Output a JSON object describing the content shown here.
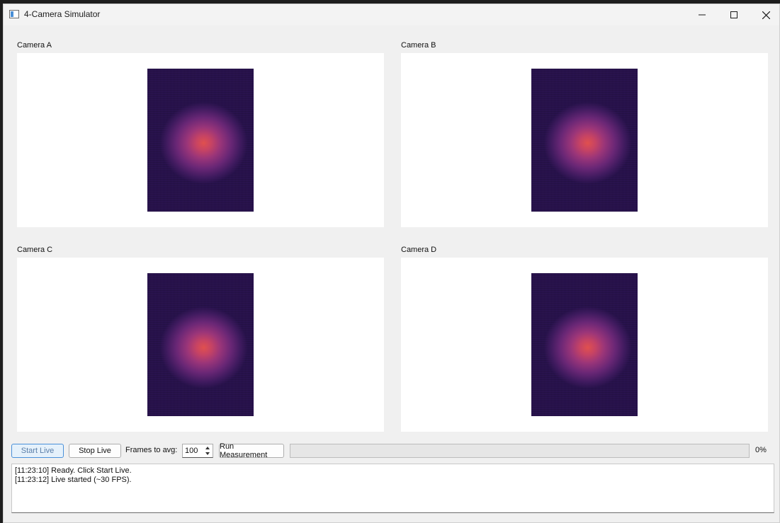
{
  "window": {
    "title": "4-Camera Simulator"
  },
  "cameras": [
    {
      "label": "Camera A"
    },
    {
      "label": "Camera B"
    },
    {
      "label": "Camera C"
    },
    {
      "label": "Camera D"
    }
  ],
  "controls": {
    "start_live": "Start Live",
    "stop_live": "Stop Live",
    "frames_label": "Frames to avg:",
    "frames_value": "100",
    "run_measurement": "Run Measurement",
    "progress_percent": 0,
    "progress_text": "0%"
  },
  "log": {
    "lines": [
      "[11:23:10] Ready. Click Start Live.",
      "[11:23:12] Live started (~30 FPS)."
    ]
  },
  "colors": {
    "accent": "#4a90d9",
    "image_background": "#2a1350",
    "image_hotspot": "#e0504e"
  }
}
